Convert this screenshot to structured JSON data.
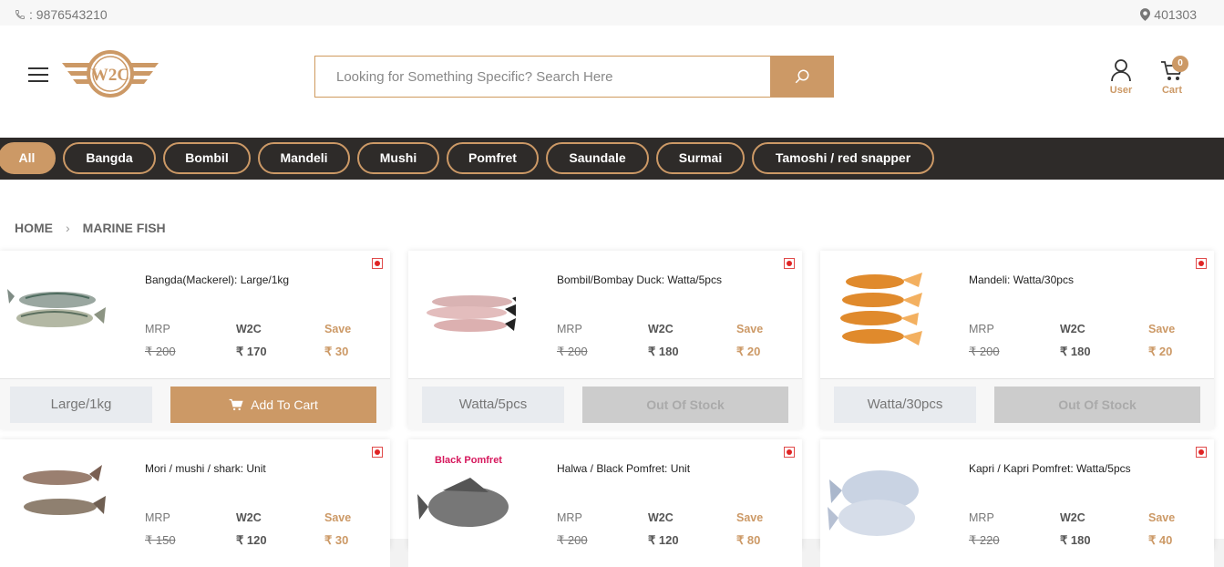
{
  "topbar": {
    "phone": ": 9876543210",
    "pincode": "401303"
  },
  "header": {
    "logo_text": "W2C",
    "search_placeholder": "Looking for Something Specific? Search Here",
    "user_label": "User",
    "cart_label": "Cart",
    "cart_count": "0"
  },
  "categories": [
    "All",
    "Bangda",
    "Bombil",
    "Mandeli",
    "Mushi",
    "Pomfret",
    "Saundale",
    "Surmai",
    "Tamoshi / red snapper"
  ],
  "breadcrumb": {
    "home": "HOME",
    "current": "MARINE FISH"
  },
  "price_labels": {
    "mrp": "MRP",
    "w2c": "W2C",
    "save": "Save"
  },
  "products": [
    {
      "name": "Bangda(Mackerel): Large/1kg",
      "mrp": "₹ 200",
      "w2c": "₹ 170",
      "save": "₹ 30",
      "variant": "Large/1kg",
      "action": "Add To Cart"
    },
    {
      "name": "Bombil/Bombay Duck: Watta/5pcs",
      "mrp": "₹ 200",
      "w2c": "₹ 180",
      "save": "₹ 20",
      "variant": "Watta/5pcs",
      "action": "Out Of Stock"
    },
    {
      "name": "Mandeli: Watta/30pcs",
      "mrp": "₹ 200",
      "w2c": "₹ 180",
      "save": "₹ 20",
      "variant": "Watta/30pcs",
      "action": "Out Of Stock"
    },
    {
      "name": "Mori / mushi / shark: Unit",
      "mrp": "₹ 150",
      "w2c": "₹ 120",
      "save": "₹ 30",
      "image_text": ""
    },
    {
      "name": "Halwa / Black Pomfret: Unit",
      "mrp": "₹ 200",
      "w2c": "₹ 120",
      "save": "₹ 80",
      "image_text": "Black Pomfret"
    },
    {
      "name": "Kapri / Kapri Pomfret: Watta/5pcs",
      "mrp": "₹ 220",
      "w2c": "₹ 180",
      "save": "₹ 40"
    }
  ],
  "colors": {
    "accent": "#cc9966",
    "nav_bg": "#2e2b29",
    "out_of_stock": "#cccccc",
    "veg_mark": "#e02424"
  }
}
